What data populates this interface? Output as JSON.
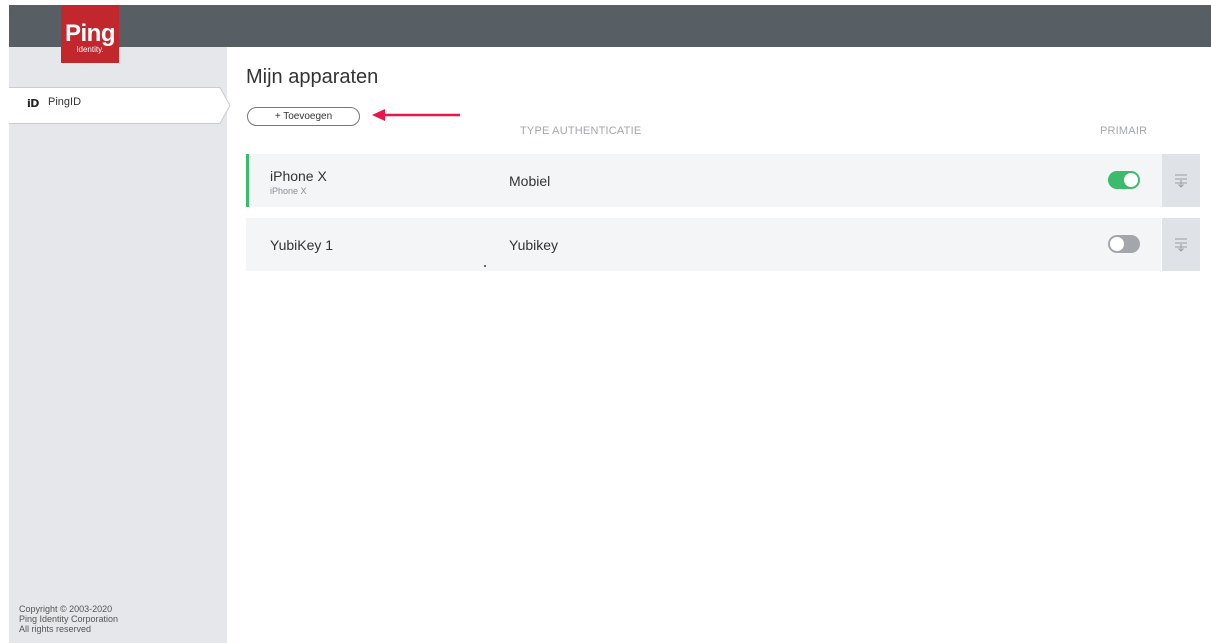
{
  "brand": {
    "logo_text": "Ping",
    "logo_sub": "Identity.",
    "color": "#c1272d"
  },
  "sidebar": {
    "items": [
      {
        "icon": "pingid-icon",
        "badge": "iD",
        "label": "PingID"
      }
    ],
    "copyright": [
      "Copyright © 2003-2020",
      "Ping Identity Corporation",
      "All rights reserved"
    ]
  },
  "main": {
    "title": "Mijn apparaten",
    "add_button": "+ Toevoegen",
    "columns": {
      "type": "TYPE AUTHENTICATIE",
      "primary": "PRIMAIR"
    },
    "devices": [
      {
        "name": "iPhone X",
        "model": "iPhone X",
        "type": "Mobiel",
        "primary": true
      },
      {
        "name": "YubiKey 1",
        "model": "",
        "type": "Yubikey",
        "primary": false
      }
    ]
  },
  "colors": {
    "topbar": "#575e64",
    "accent": "#3dbb6c",
    "arrow": "#e8174a",
    "sidebar": "#e6e7ea"
  }
}
